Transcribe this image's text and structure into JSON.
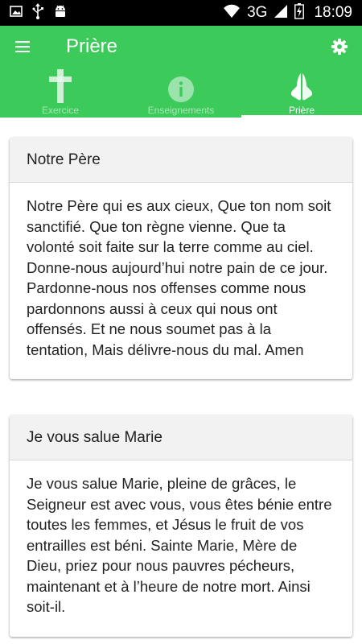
{
  "status_bar": {
    "network": "3G",
    "time": "18:09",
    "icons": [
      "image-icon",
      "usb-icon",
      "android-icon",
      "wifi-icon",
      "signal-icon",
      "battery-icon"
    ]
  },
  "toolbar": {
    "title": "Prière",
    "menu_icon": "hamburger-menu-icon",
    "settings_icon": "gear-icon"
  },
  "tabs": [
    {
      "label": "Exercice",
      "icon": "cross-icon",
      "active": false
    },
    {
      "label": "Enseignements",
      "icon": "info-icon",
      "active": false
    },
    {
      "label": "Prière",
      "icon": "praying-hands-icon",
      "active": true
    }
  ],
  "prayers": [
    {
      "title": "Notre Père",
      "text": "Notre Père qui es aux cieux, Que ton nom soit sanctifié. Que ton règne vienne. Que ta volonté soit faite sur la terre comme au ciel. Donne-nous aujourd’hui notre pain de ce jour. Pardonne-nous nos offenses comme nous pardonnons aussi à ceux qui nous ont offensés. Et ne nous soumet pas à la tentation, Mais délivre-nous du mal. Amen"
    },
    {
      "title": "Je vous salue Marie",
      "text": "Je vous salue Marie, pleine de grâces, le Seigneur est avec vous, vous êtes bénie entre toutes les femmes, et Jésus le fruit de vos entrailles est béni. Sainte Marie, Mère de Dieu, priez pour nous pauvres pécheurs, maintenant et à l’heure de notre mort. Ainsi soit-il."
    }
  ],
  "colors": {
    "primary": "#3ccb5b",
    "status_bar": "#000000",
    "card_header": "#f2f2f2"
  }
}
